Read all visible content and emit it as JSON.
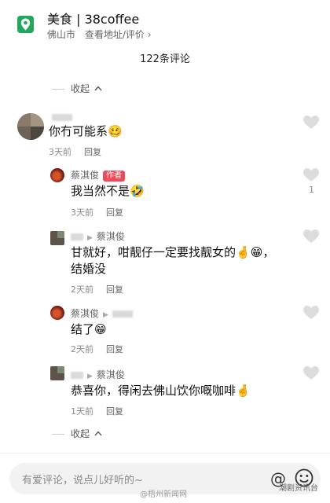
{
  "header": {
    "title": "美食 | 38coffee",
    "city": "佛山市",
    "link": "查看地址/评价 ›"
  },
  "comment_count": "122条评论",
  "collapse_label": "收起",
  "collapse_chevron": "^",
  "comments": [
    {
      "text": "你冇可能系",
      "emoji": "🥴",
      "time": "3天前",
      "reply": "回复"
    },
    {
      "name": "蔡淇俊",
      "author_tag": "作者",
      "text": "我当然不是",
      "emoji": "🤣",
      "time": "3天前",
      "reply": "回复",
      "likes": "1"
    },
    {
      "name": "蔡淇俊",
      "text_line1": "甘就好，咁靓仔一定要找靓女的",
      "emoji1": "🤞",
      "emoji2": "😁",
      "text_line1_end": "，",
      "text_line2": "结婚没",
      "time": "2天前",
      "reply": "回复"
    },
    {
      "name": "蔡淇俊",
      "text": "结了",
      "emoji": "😁",
      "time": "2天前",
      "reply": "回复"
    },
    {
      "name": "蔡淇俊",
      "text": "恭喜你，得闲去佛山饮你嘅咖啡",
      "emoji": "🤞",
      "time": "1天前",
      "reply": "回复"
    }
  ],
  "input": {
    "placeholder": "有爱评论，说点儿好听的~",
    "at_symbol": "@"
  },
  "watermark": {
    "source": "@梧州新闻网",
    "channel": "潮剧资讯台"
  },
  "colors": {
    "author_tag": "#f04a5a",
    "location_icon": "#22a85a"
  }
}
